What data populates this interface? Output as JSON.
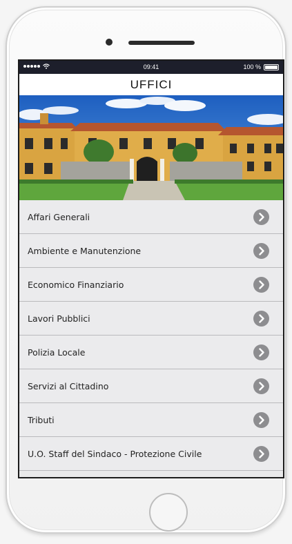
{
  "status_bar": {
    "time": "09:41",
    "battery": "100 %",
    "battery_level": 1.0
  },
  "header": {
    "title": "UFFICI"
  },
  "list": {
    "items": [
      {
        "label": "Affari Generali"
      },
      {
        "label": "Ambiente e Manutenzione"
      },
      {
        "label": "Economico Finanziario"
      },
      {
        "label": "Lavori Pubblici"
      },
      {
        "label": "Polizia Locale"
      },
      {
        "label": "Servizi al Cittadino"
      },
      {
        "label": "Tributi"
      },
      {
        "label": "U.O. Staff del Sindaco - Protezione Civile"
      }
    ]
  },
  "icons": {
    "row_arrow": "chevron-right-icon",
    "signal": "signal-dots-icon",
    "wifi": "wifi-icon",
    "battery": "battery-icon"
  },
  "colors": {
    "status_bar_bg": "#1d1f2b",
    "list_bg": "#ebebed",
    "arrow_bg": "#8d8d90",
    "sky": "#2e6fc8",
    "building": "#d9a441"
  }
}
